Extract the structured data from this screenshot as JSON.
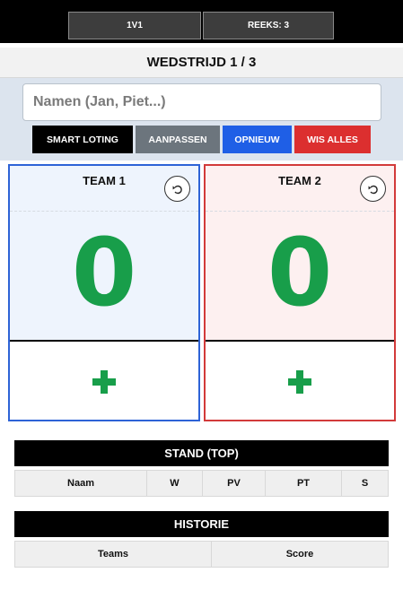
{
  "topbar": {
    "mode_label": "1V1",
    "series_label": "REEKS: 3"
  },
  "match": {
    "title": "WEDSTRIJD 1 / 3"
  },
  "setup": {
    "names_placeholder": "Namen (Jan, Piet...)",
    "names_value": "",
    "buttons": {
      "smart": "SMART LOTING",
      "edit": "AANPASSEN",
      "restart": "OPNIEUW",
      "clear": "WIS ALLES"
    }
  },
  "teams": [
    {
      "name": "TEAM 1",
      "score": "0",
      "accent": "#2e63d6",
      "undo_icon": "undo-arrow",
      "add_icon": "plus"
    },
    {
      "name": "TEAM 2",
      "score": "0",
      "accent": "#d23a3a",
      "undo_icon": "undo-arrow",
      "add_icon": "plus"
    }
  ],
  "standings": {
    "title": "STAND (TOP)",
    "columns": [
      "Naam",
      "W",
      "PV",
      "PT",
      "S"
    ]
  },
  "history": {
    "title": "HISTORIE",
    "columns": [
      "Teams",
      "Score"
    ]
  },
  "colors": {
    "score_green": "#189e4a",
    "team1": "#2e63d6",
    "team2": "#d23a3a"
  }
}
